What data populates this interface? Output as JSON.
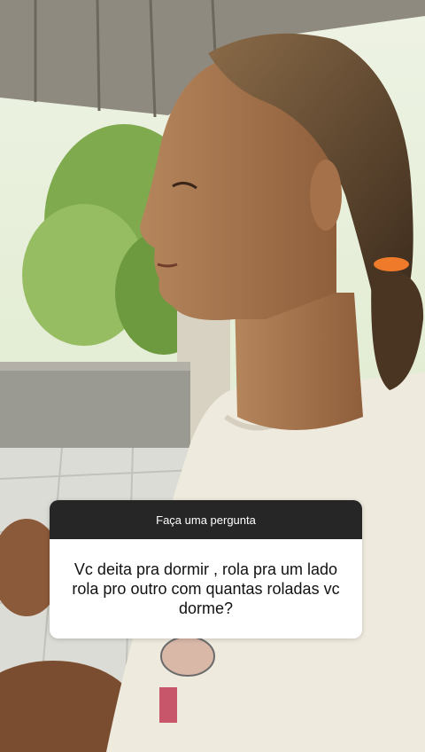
{
  "story": {
    "background_photo": "woman-in-profile-outdoors",
    "question_box": {
      "header": "Faça uma pergunta",
      "question": "Vc deita pra dormir , rola pra um lado rola pro outro com quantas roladas vc dorme?"
    }
  },
  "colors": {
    "header_bg": "#262626",
    "card_bg": "#ffffff"
  }
}
